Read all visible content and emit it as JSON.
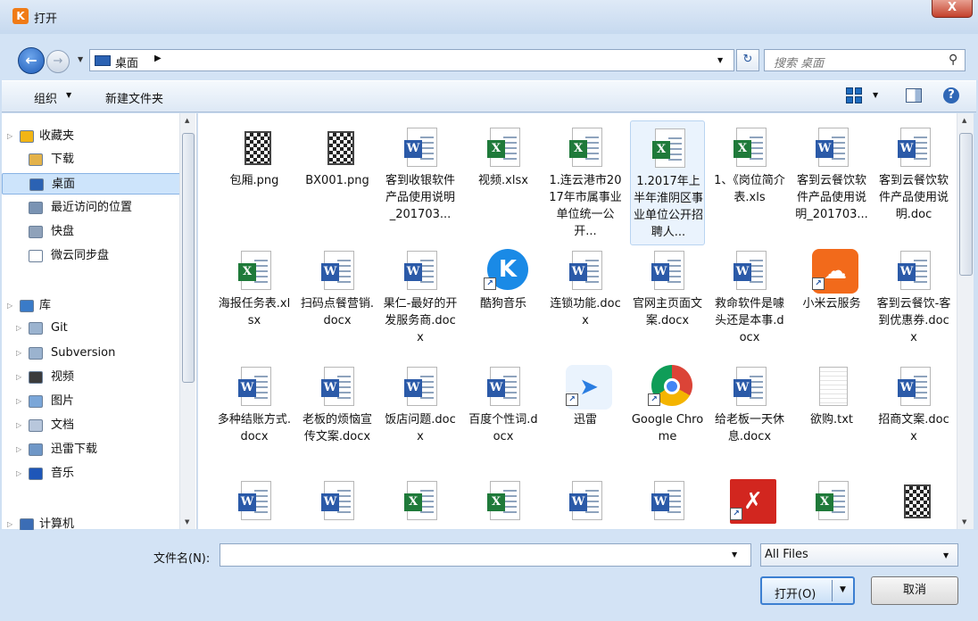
{
  "window": {
    "title": "打开",
    "close_label": "X"
  },
  "address": {
    "path": "桌面",
    "search_placeholder": "搜索 桌面"
  },
  "toolbar": {
    "organize_label": "组织",
    "new_folder_label": "新建文件夹"
  },
  "sidebar": {
    "items": [
      {
        "label": "收藏夹",
        "icon": "star-icon"
      },
      {
        "label": "下载",
        "icon": "download-folder-icon"
      },
      {
        "label": "桌面",
        "icon": "desktop-icon"
      },
      {
        "label": "最近访问的位置",
        "icon": "recent-places-icon"
      },
      {
        "label": "快盘",
        "icon": "kuaipan-icon"
      },
      {
        "label": "微云同步盘",
        "icon": "weiyun-icon"
      },
      {
        "label": "库",
        "icon": "library-icon"
      },
      {
        "label": "Git",
        "icon": "git-folder-icon"
      },
      {
        "label": "Subversion",
        "icon": "subversion-folder-icon"
      },
      {
        "label": "视频",
        "icon": "video-library-icon"
      },
      {
        "label": "图片",
        "icon": "picture-library-icon"
      },
      {
        "label": "文档",
        "icon": "document-library-icon"
      },
      {
        "label": "迅雷下载",
        "icon": "xunlei-download-icon"
      },
      {
        "label": "音乐",
        "icon": "music-library-icon"
      },
      {
        "label": "计算机",
        "icon": "computer-icon"
      }
    ]
  },
  "files": [
    {
      "name": "包厢.png",
      "type": "qr"
    },
    {
      "name": "BX001.png",
      "type": "qr"
    },
    {
      "name": "客到收银软件产品使用说明_201703...",
      "type": "word"
    },
    {
      "name": "视频.xlsx",
      "type": "excel"
    },
    {
      "name": "1.连云港市2017年市属事业单位统一公开...",
      "type": "excel"
    },
    {
      "name": "1.2017年上半年淮阴区事业单位公开招聘人...",
      "type": "excel"
    },
    {
      "name": "1、《岗位简介表.xls",
      "type": "excel"
    },
    {
      "name": "客到云餐饮软件产品使用说明_201703...",
      "type": "word"
    },
    {
      "name": "客到云餐饮软件产品使用说明.doc",
      "type": "word"
    },
    {
      "name": "海报任务表.xlsx",
      "type": "excel"
    },
    {
      "name": "扫码点餐营销.docx",
      "type": "word"
    },
    {
      "name": "果仁-最好的开发服务商.docx",
      "type": "word"
    },
    {
      "name": "酷狗音乐",
      "type": "kugou"
    },
    {
      "name": "连锁功能.docx",
      "type": "word"
    },
    {
      "name": "官网主页面文案.docx",
      "type": "word"
    },
    {
      "name": "救命软件是噱头还是本事.docx",
      "type": "word"
    },
    {
      "name": "小米云服务",
      "type": "micloud"
    },
    {
      "name": "客到云餐饮-客到优惠券.docx",
      "type": "word"
    },
    {
      "name": "多种结账方式.docx",
      "type": "word"
    },
    {
      "name": "老板的烦恼宣传文案.docx",
      "type": "word"
    },
    {
      "name": "饭店问题.docx",
      "type": "word"
    },
    {
      "name": "百度个性词.docx",
      "type": "word"
    },
    {
      "name": "迅雷",
      "type": "xunlei"
    },
    {
      "name": "Google Chrome",
      "type": "chrome"
    },
    {
      "name": "给老板一天休息.docx",
      "type": "word"
    },
    {
      "name": "欲购.txt",
      "type": "txt"
    },
    {
      "name": "招商文案.docx",
      "type": "word"
    },
    {
      "name": "",
      "type": "word"
    },
    {
      "name": "",
      "type": "word"
    },
    {
      "name": "",
      "type": "excel"
    },
    {
      "name": "",
      "type": "excel"
    },
    {
      "name": "",
      "type": "word"
    },
    {
      "name": "",
      "type": "word"
    },
    {
      "name": "",
      "type": "xmind"
    },
    {
      "name": "",
      "type": "excel"
    },
    {
      "name": "",
      "type": "qr"
    }
  ],
  "footer": {
    "filename_label": "文件名(N):",
    "filename_value": "",
    "file_type": "All Files",
    "open_label": "打开(O)",
    "cancel_label": "取消"
  },
  "colors": {
    "word": "#2b5aa8",
    "excel": "#1f7a3a",
    "kugou": "#1a8ae6",
    "micloud": "#f26a1b",
    "xmind": "#d2261f"
  }
}
